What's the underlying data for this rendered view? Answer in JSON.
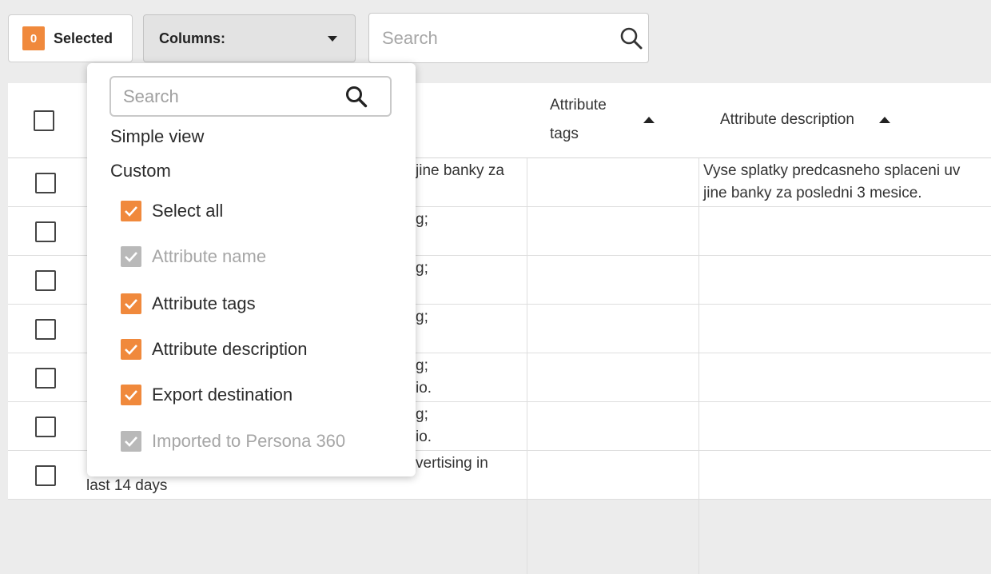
{
  "toolbar": {
    "selected_count": "0",
    "selected_label": "Selected",
    "columns_label": "Columns:",
    "search_placeholder": "Search"
  },
  "table": {
    "headers": {
      "tags_line1": "Attribute",
      "tags_line2": "tags",
      "description": "Attribute description"
    },
    "rows": [
      {
        "name_fragment": "jine banky za",
        "description_line1": "Vyse splatky predcasneho splaceni uv",
        "description_line2": "jine banky za posledni 3 mesice."
      },
      {
        "name_fragment": "g;",
        "description_line1": "",
        "description_line2": ""
      },
      {
        "name_fragment": "g;",
        "description_line1": "",
        "description_line2": ""
      },
      {
        "name_fragment": "g;",
        "description_line1": "",
        "description_line2": ""
      },
      {
        "name_fragment": "g;",
        "name_fragment2": "io.",
        "description_line1": "",
        "description_line2": ""
      },
      {
        "name_fragment": "g;",
        "name_fragment2": "io.",
        "description_line1": "",
        "description_line2": ""
      },
      {
        "name_fragment": "vertising in",
        "name_fragment2": "last 14 days",
        "description_line1": "",
        "description_line2": ""
      }
    ]
  },
  "dropdown": {
    "search_placeholder": "Search",
    "simple_view": "Simple view",
    "custom": "Custom",
    "options": [
      {
        "label": "Select all",
        "checked": true,
        "disabled": false
      },
      {
        "label": "Attribute name",
        "checked": true,
        "disabled": true
      },
      {
        "label": "Attribute tags",
        "checked": true,
        "disabled": false
      },
      {
        "label": "Attribute description",
        "checked": true,
        "disabled": false
      },
      {
        "label": "Export destination",
        "checked": true,
        "disabled": false
      },
      {
        "label": "Imported to Persona 360",
        "checked": true,
        "disabled": true
      }
    ]
  },
  "colors": {
    "accent": "#f0893c",
    "disabled_check": "#b9b9b9",
    "background": "#ececec"
  }
}
